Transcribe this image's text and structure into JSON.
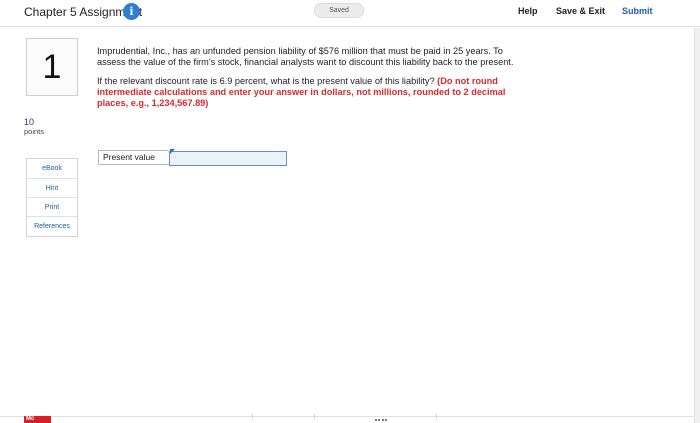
{
  "header": {
    "title": "Chapter 5 Assignment",
    "info_icon": "i",
    "saved_status": "Saved",
    "help_label": "Help",
    "save_exit_label": "Save & Exit",
    "submit_label": "Submit"
  },
  "question": {
    "number": "1",
    "points_value": "10",
    "points_label": "points",
    "paragraph": "Imprudential, Inc., has an unfunded pension liability of $576 million that must be paid in 25 years. To assess the value of the firm's stock, financial analysts want to discount this liability back to the present.",
    "prompt": "If the relevant discount rate is 6.9 percent, what is the present value of this liability?",
    "instructions": "(Do not round intermediate calculations and enter your answer in dollars, not millions, rounded to 2 decimal places, e.g., 1,234,567.89)"
  },
  "tools": {
    "ebook": "eBook",
    "hint": "Hint",
    "print": "Print",
    "references": "References"
  },
  "answer": {
    "label": "Present value",
    "value": ""
  },
  "footer": {
    "logo": "Mc"
  },
  "colors": {
    "accent": "#1f5ca8",
    "instruction_red": "#d82a2a",
    "info_blue": "#2f7fcf",
    "logo_red": "#d81f26"
  }
}
